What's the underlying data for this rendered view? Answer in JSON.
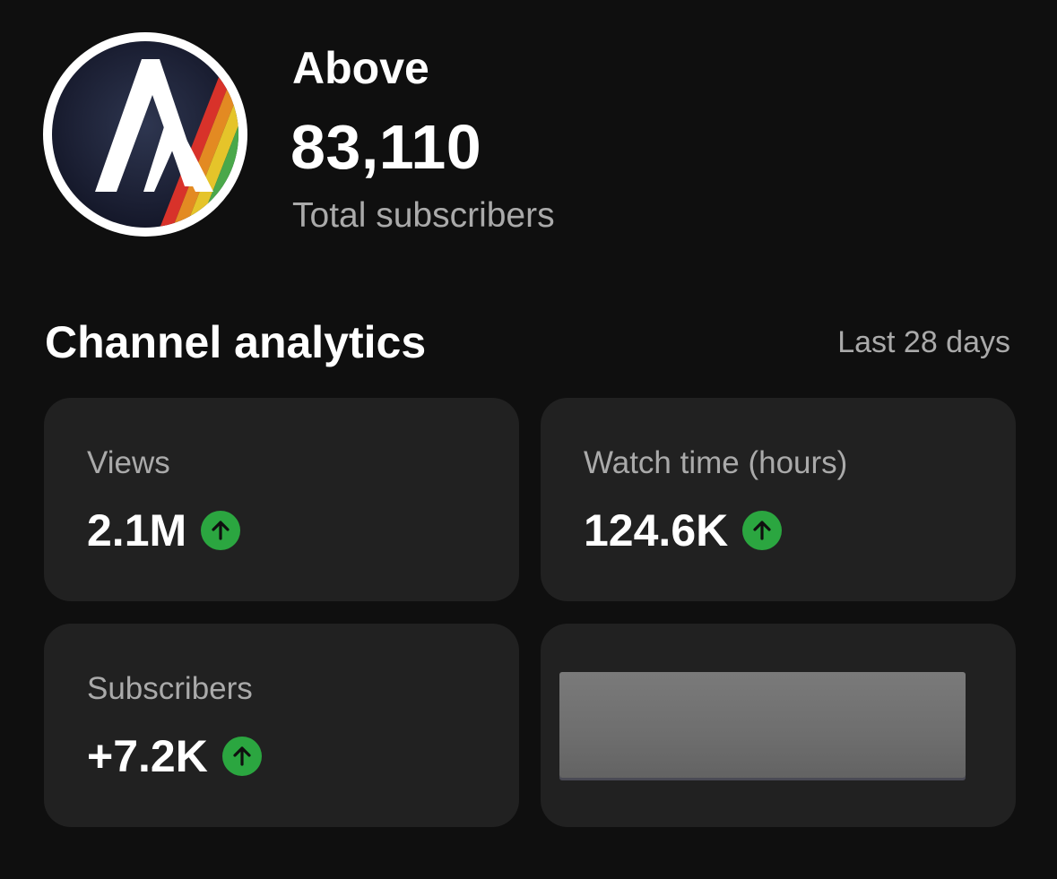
{
  "channel": {
    "name": "Above",
    "subscriber_count": "83,110",
    "subscriber_label": "Total subscribers",
    "avatar_icon": "mountain-logo-icon"
  },
  "analytics": {
    "title": "Channel analytics",
    "period": "Last 28 days",
    "cards": [
      {
        "label": "Views",
        "value": "2.1M",
        "trend": "up"
      },
      {
        "label": "Watch time (hours)",
        "value": "124.6K",
        "trend": "up"
      },
      {
        "label": "Subscribers",
        "value": "+7.2K",
        "trend": "up"
      }
    ],
    "redacted_card": true
  },
  "colors": {
    "background": "#0f0f0f",
    "card": "#212121",
    "trend_up": "#2ba640",
    "muted_text": "#aaaaaa"
  }
}
